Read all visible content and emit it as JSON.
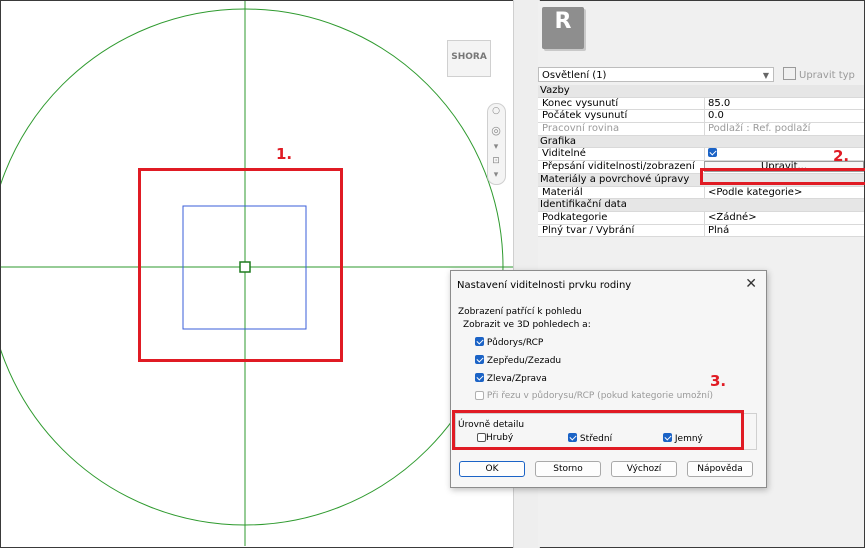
{
  "view_cube": {
    "label": "SHORA"
  },
  "app_logo": {
    "letter": "R"
  },
  "properties": {
    "type_selector": "Osvětlení (1)",
    "edit_type": "Upravit typ",
    "rows": [
      {
        "kind": "cat",
        "label": "Vazby"
      },
      {
        "kind": "prop",
        "label": "Konec vysunutí",
        "value": "85.0"
      },
      {
        "kind": "prop",
        "label": "Počátek vysunutí",
        "value": "0.0"
      },
      {
        "kind": "prop-dis",
        "label": "Pracovní rovina",
        "value": "Podlaží : Ref. podlaží"
      },
      {
        "kind": "cat",
        "label": "Grafika"
      },
      {
        "kind": "prop-check",
        "label": "Viditelné"
      },
      {
        "kind": "prop-btn",
        "label": "Přepsání viditelnosti/zobrazení",
        "value": "Upravit..."
      },
      {
        "kind": "cat",
        "label": "Materiály a povrchové úpravy"
      },
      {
        "kind": "prop",
        "label": "Materiál",
        "value": "<Podle kategorie>"
      },
      {
        "kind": "cat",
        "label": "Identifikační data"
      },
      {
        "kind": "prop",
        "label": "Podkategorie",
        "value": "<Žádné>"
      },
      {
        "kind": "prop",
        "label": "Plný tvar / Vybrání",
        "value": "Plná"
      }
    ]
  },
  "dialog": {
    "title": "Nastavení viditelnosti prvku rodiny",
    "close": "✕",
    "section_view": "Zobrazení patřící k pohledu",
    "section_3d": "Zobrazit ve 3D pohledech a:",
    "opt_plan": "Půdorys/RCP",
    "opt_front": "Zepředu/Zezadu",
    "opt_left": "Zleva/Zprava",
    "opt_cut": "Při řezu v půdorysu/RCP (pokud kategorie umožní)",
    "section_detail": "Úrovně detailu",
    "detail_coarse": "Hrubý",
    "detail_medium": "Střední",
    "detail_fine": "Jemný",
    "btn_ok": "OK",
    "btn_cancel": "Storno",
    "btn_default": "Výchozí",
    "btn_help": "Nápověda"
  },
  "annotations": {
    "n1": "1.",
    "n2": "2.",
    "n3": "3."
  },
  "colors": {
    "highlight": "#e01b24",
    "axis": "#2e9a2e",
    "box": "#3a5ed8",
    "check": "#1b63c6"
  }
}
